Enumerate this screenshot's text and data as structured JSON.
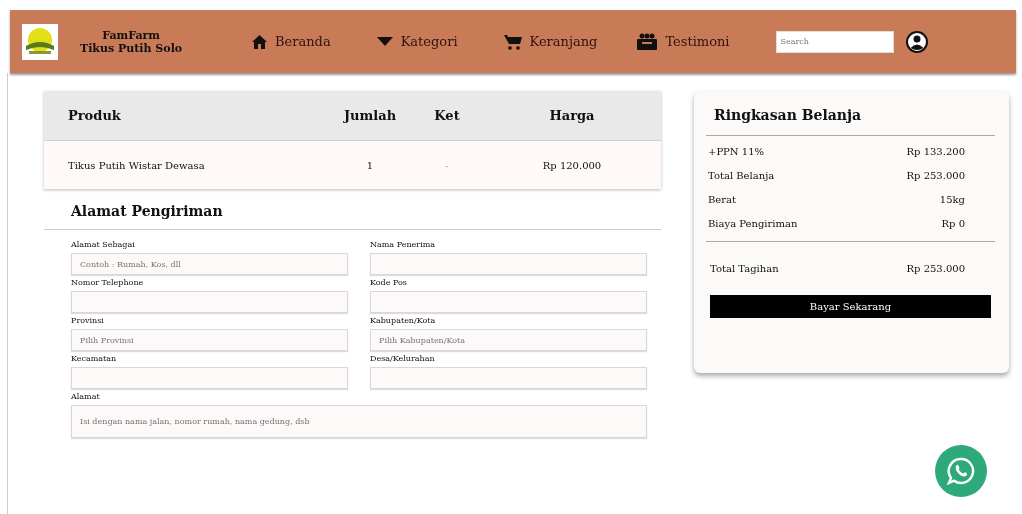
{
  "header": {
    "brand": [
      "FamFarm",
      "Tikus Putih Solo"
    ],
    "nav": [
      {
        "label": "Beranda"
      },
      {
        "label": "Kategori"
      },
      {
        "label": "Keranjang"
      },
      {
        "label": "Testimoni"
      }
    ],
    "search": {
      "placeholder": "Search"
    }
  },
  "cart_table": {
    "columns": [
      "Produk",
      "Jumlah",
      "Ket",
      "Harga"
    ],
    "rows": [
      [
        "Tikus Putih Wistar Dewasa",
        "1",
        "-",
        "Rp 120.000"
      ]
    ]
  },
  "shipping": {
    "title": "Alamat Pengiriman",
    "fields": [
      {
        "label": "Alamat Sebagai",
        "placeholder": "Contoh : Rumah, Kos, dll"
      },
      {
        "label": "Nama Penerima"
      },
      {
        "label": "Nomor Telephone"
      },
      {
        "label": "Kode Pos"
      },
      {
        "label": "Provinsi",
        "placeholder": "Pilih Provinsi"
      },
      {
        "label": "Kabupaten/Kota",
        "placeholder": "Pilih Kabupaten/Kota"
      },
      {
        "label": "Kecamatan"
      },
      {
        "label": "Desa/Kelurahan"
      },
      {
        "label": "Alamat",
        "placeholder": "Isi dengan nama jalan, nomor rumah, nama gedung, dsb"
      }
    ]
  },
  "summary": {
    "title": "Ringkasan Belanja",
    "lines": [
      {
        "label": "+PPN 11%",
        "value": "Rp 133.200"
      },
      {
        "label": "Total Belanja",
        "value": "Rp 253.000"
      },
      {
        "label": "Berat",
        "value": "15kg"
      },
      {
        "label": "Biaya Pengiriman",
        "value": "Rp 0"
      }
    ],
    "total": {
      "label": "Total Tagihan",
      "value": "Rp 253.000"
    },
    "button": "Bayar Sekarang"
  }
}
